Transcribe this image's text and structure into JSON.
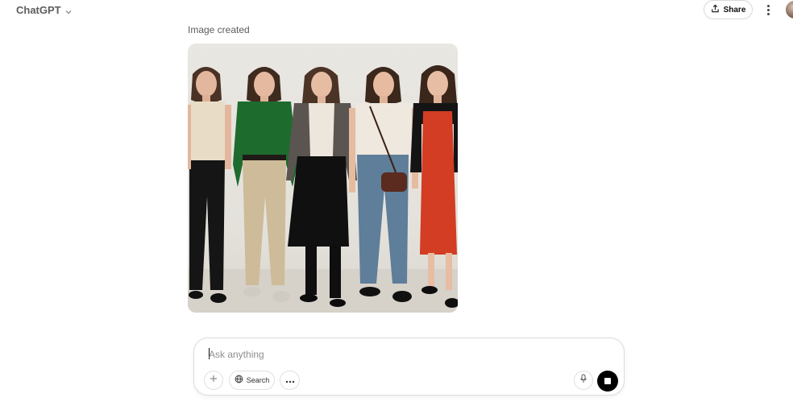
{
  "header": {
    "model_label": "ChatGPT",
    "share_label": "Share"
  },
  "message": {
    "status": "Image created"
  },
  "composer": {
    "placeholder": "Ask anything",
    "search_label": "Search"
  },
  "colors": {
    "accent": "#000000",
    "border": "#dcdcdc",
    "muted_text": "#5d5d5d"
  },
  "icons": [
    "chevron-down-icon",
    "share-icon",
    "more-vertical-icon",
    "avatar",
    "plus-icon",
    "globe-icon",
    "more-horizontal-icon",
    "microphone-icon",
    "stop-icon"
  ]
}
